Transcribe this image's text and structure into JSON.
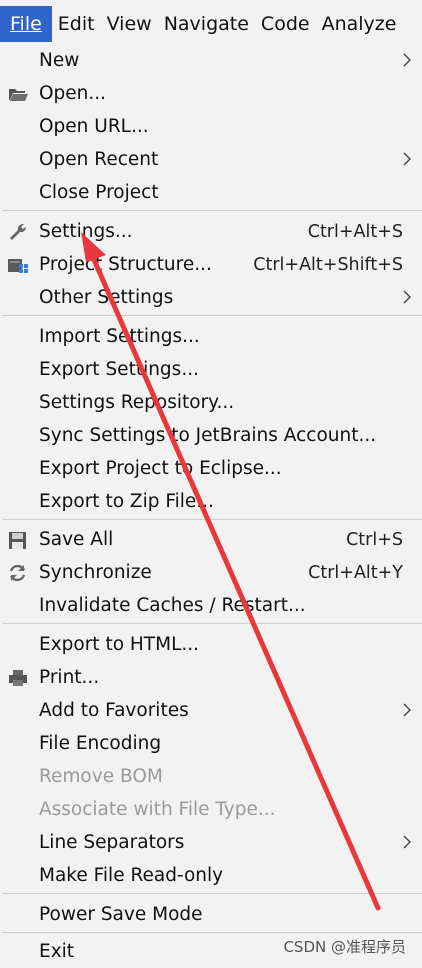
{
  "menubar": [
    {
      "name": "menu-file",
      "label": "File",
      "active": true
    },
    {
      "name": "menu-edit",
      "label": "Edit"
    },
    {
      "name": "menu-view",
      "label": "View"
    },
    {
      "name": "menu-navigate",
      "label": "Navigate"
    },
    {
      "name": "menu-code",
      "label": "Code"
    },
    {
      "name": "menu-analyze",
      "label": "Analyze"
    }
  ],
  "file_menu": {
    "new": {
      "label": "New",
      "submenu": true
    },
    "open": {
      "label": "Open...",
      "icon": "folder-open-icon"
    },
    "open_url": {
      "label": "Open URL..."
    },
    "open_recent": {
      "label": "Open Recent",
      "submenu": true
    },
    "close_project": {
      "label": "Close Project"
    },
    "settings": {
      "label": "Settings...",
      "shortcut": "Ctrl+Alt+S",
      "icon": "wrench-icon"
    },
    "project_structure": {
      "label": "Project Structure...",
      "shortcut": "Ctrl+Alt+Shift+S",
      "icon": "project-structure-icon"
    },
    "other_settings": {
      "label": "Other Settings",
      "submenu": true
    },
    "import_settings": {
      "label": "Import Settings..."
    },
    "export_settings": {
      "label": "Export Settings..."
    },
    "settings_repository": {
      "label": "Settings Repository..."
    },
    "sync_settings": {
      "label": "Sync Settings to JetBrains Account..."
    },
    "export_eclipse": {
      "label": "Export Project to Eclipse..."
    },
    "export_zip": {
      "label": "Export to Zip File..."
    },
    "save_all": {
      "label": "Save All",
      "shortcut": "Ctrl+S",
      "icon": "save-icon"
    },
    "synchronize": {
      "label": "Synchronize",
      "shortcut": "Ctrl+Alt+Y",
      "icon": "sync-icon"
    },
    "invalidate_caches": {
      "label": "Invalidate Caches / Restart..."
    },
    "export_html": {
      "label": "Export to HTML..."
    },
    "print": {
      "label": "Print...",
      "icon": "printer-icon"
    },
    "add_favorites": {
      "label": "Add to Favorites",
      "submenu": true
    },
    "file_encoding": {
      "label": "File Encoding"
    },
    "remove_bom": {
      "label": "Remove BOM",
      "disabled": true
    },
    "associate_file_type": {
      "label": "Associate with File Type...",
      "disabled": true
    },
    "line_separators": {
      "label": "Line Separators",
      "submenu": true
    },
    "make_read_only": {
      "label": "Make File Read-only"
    },
    "power_save": {
      "label": "Power Save Mode"
    },
    "exit": {
      "label": "Exit"
    }
  },
  "watermark": "CSDN @准程序员",
  "colors": {
    "accent": "#2f65ca",
    "annotation_arrow": "#e8383d",
    "disabled_text": "#9a9a9a",
    "menu_bg": "#f2f2f2"
  }
}
